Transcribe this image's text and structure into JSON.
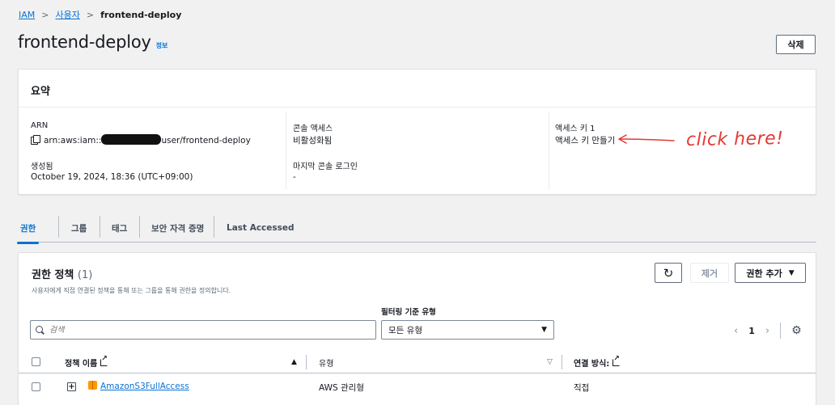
{
  "breadcrumb": {
    "root": "IAM",
    "parent": "사용자",
    "current": "frontend-deploy"
  },
  "header": {
    "title": "frontend-deploy",
    "info": "정보",
    "delete_label": "삭제"
  },
  "summary": {
    "title": "요약",
    "arn_label": "ARN",
    "arn_prefix": "arn:aws:iam::",
    "arn_suffix": "user/frontend-deploy",
    "created_label": "생성됨",
    "created_value": "October 19, 2024, 18:36 (UTC+09:00)",
    "console_access_label": "콘솔 액세스",
    "console_access_value": "비활성화됨",
    "last_login_label": "마지막 콘솔 로그인",
    "last_login_value": "-",
    "access_key_label": "액세스 키 1",
    "access_key_link": "액세스 키 만들기"
  },
  "annotation": {
    "text": "click here!",
    "color": "#e53935"
  },
  "tabs": [
    {
      "label": "권한",
      "active": true
    },
    {
      "label": "그룹"
    },
    {
      "label": "태그"
    },
    {
      "label": "보안 자격 증명"
    },
    {
      "label": "Last Accessed"
    }
  ],
  "policies": {
    "title": "권한 정책",
    "count": "(1)",
    "description": "사용자에게 직접 연결된 정책을 통해 또는 그룹을 통해 권한을 정의합니다.",
    "remove_label": "제거",
    "add_label": "권한 추가",
    "filter_label": "필터링 기준 유형",
    "search_placeholder": "검색",
    "filter_selected": "모든 유형",
    "page_number": "1",
    "columns": {
      "name": "정책 이름",
      "type": "유형",
      "attached": "연결 방식:"
    },
    "rows": [
      {
        "name": "AmazonS3FullAccess",
        "type": "AWS 관리형",
        "attached": "직접"
      }
    ]
  },
  "colors": {
    "link": "#0972d3",
    "accent": "#0972d3",
    "annotation": "#e53935"
  }
}
